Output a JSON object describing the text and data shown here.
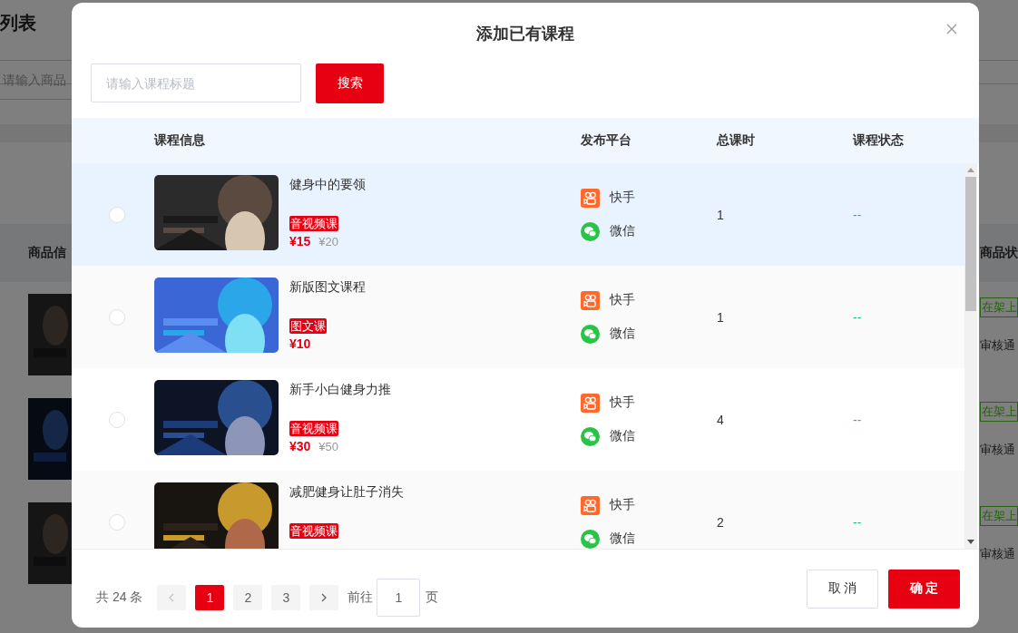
{
  "background_page": {
    "title": "列表",
    "search_placeholder": "请输入商品",
    "columns": [
      "商品信",
      "商品状"
    ],
    "rows": [
      {
        "status": "在架上",
        "review": "审核通"
      },
      {
        "status": "在架上",
        "review": "审核通"
      },
      {
        "status": "在架上",
        "review": "审核通"
      }
    ]
  },
  "dialog": {
    "title": "添加已有课程",
    "search": {
      "placeholder": "请输入课程标题",
      "button": "搜索"
    },
    "table": {
      "columns": [
        "课程信息",
        "发布平台",
        "总课时",
        "课程状态"
      ],
      "rows": [
        {
          "selected": false,
          "highlighted": true,
          "title": "健身中的要领",
          "tag": "音视频课",
          "price": "¥15",
          "original_price": "¥20",
          "platforms": [
            {
              "kind": "kuaishou",
              "name": "快手"
            },
            {
              "kind": "wechat",
              "name": "微信"
            }
          ],
          "hours": "1",
          "status": "--"
        },
        {
          "selected": false,
          "highlighted": false,
          "title": "新版图文课程",
          "tag": "图文课",
          "price": "¥10",
          "platforms": [
            {
              "kind": "kuaishou",
              "name": "快手"
            },
            {
              "kind": "wechat",
              "name": "微信"
            }
          ],
          "hours": "1",
          "status": "--"
        },
        {
          "selected": false,
          "highlighted": false,
          "title": "新手小白健身力推",
          "tag": "音视频课",
          "price": "¥30",
          "original_price": "¥50",
          "platforms": [
            {
              "kind": "kuaishou",
              "name": "快手"
            },
            {
              "kind": "wechat",
              "name": "微信"
            }
          ],
          "hours": "4",
          "status": "--"
        },
        {
          "selected": false,
          "highlighted": false,
          "title": "减肥健身让肚子消失",
          "tag": "音视频课",
          "platforms": [
            {
              "kind": "kuaishou",
              "name": "快手"
            },
            {
              "kind": "wechat",
              "name": "微信"
            }
          ],
          "hours": "2",
          "status": "--"
        }
      ]
    },
    "pagination": {
      "total": "共 24 条",
      "prev_disabled": true,
      "next_disabled": false,
      "pages": [
        {
          "label": "1",
          "selected": true
        },
        {
          "label": "2",
          "selected": false
        },
        {
          "label": "3",
          "selected": false
        }
      ],
      "goto_label": "前往",
      "page_input": "1",
      "page_suffix": "页"
    },
    "buttons": {
      "cancel": "取 消",
      "confirm": "确 定"
    }
  }
}
